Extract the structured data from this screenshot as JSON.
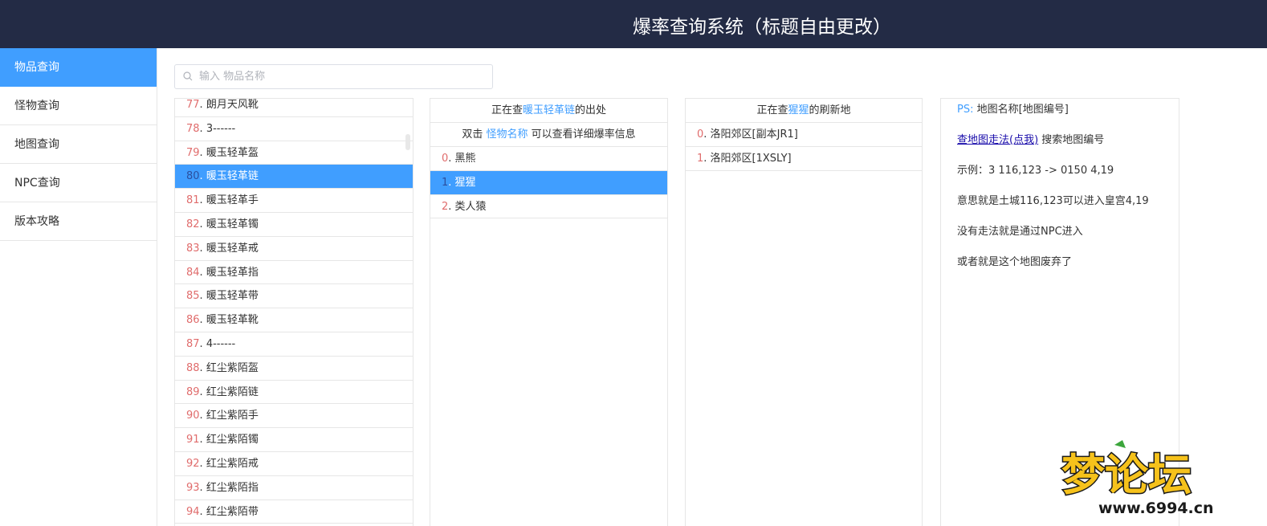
{
  "header": {
    "title": "爆率查询系统（标题自由更改）"
  },
  "sidebar": {
    "items": [
      {
        "label": "物品查询",
        "active": true
      },
      {
        "label": "怪物查询",
        "active": false
      },
      {
        "label": "地图查询",
        "active": false
      },
      {
        "label": "NPC查询",
        "active": false
      },
      {
        "label": "版本攻略",
        "active": false
      }
    ]
  },
  "search": {
    "placeholder": "输入 物品名称",
    "value": "",
    "icon": "search-icon"
  },
  "items_list": {
    "items": [
      {
        "num": "77",
        "name": "朗月天风靴"
      },
      {
        "num": "78",
        "name": "3------"
      },
      {
        "num": "79",
        "name": "暖玉轻革盔"
      },
      {
        "num": "80",
        "name": "暖玉轻革链",
        "selected": true
      },
      {
        "num": "81",
        "name": "暖玉轻革手"
      },
      {
        "num": "82",
        "name": "暖玉轻革镯"
      },
      {
        "num": "83",
        "name": "暖玉轻革戒"
      },
      {
        "num": "84",
        "name": "暖玉轻革指"
      },
      {
        "num": "85",
        "name": "暖玉轻革带"
      },
      {
        "num": "86",
        "name": "暖玉轻革靴"
      },
      {
        "num": "87",
        "name": "4------"
      },
      {
        "num": "88",
        "name": "红尘紫陌盔"
      },
      {
        "num": "89",
        "name": "红尘紫陌链"
      },
      {
        "num": "90",
        "name": "红尘紫陌手"
      },
      {
        "num": "91",
        "name": "红尘紫陌镯"
      },
      {
        "num": "92",
        "name": "红尘紫陌戒"
      },
      {
        "num": "93",
        "name": "红尘紫陌指"
      },
      {
        "num": "94",
        "name": "红尘紫陌带"
      }
    ]
  },
  "source_panel": {
    "head_prefix": "正在查",
    "head_item": "暖玉轻革链",
    "head_suffix": "的出处",
    "hint_prefix": "双击 ",
    "hint_link": "怪物名称",
    "hint_suffix": " 可以查看详细爆率信息",
    "monsters": [
      {
        "num": "0",
        "name": "黑熊"
      },
      {
        "num": "1",
        "name": "猩猩",
        "selected": true
      },
      {
        "num": "2",
        "name": "类人猿"
      }
    ]
  },
  "map_panel": {
    "head_prefix": "正在查",
    "head_monster": "猩猩",
    "head_suffix": "的刷新地",
    "maps": [
      {
        "num": "0",
        "name": "洛阳郊区[副本JR1]"
      },
      {
        "num": "1",
        "name": "洛阳郊区[1XSLY]"
      }
    ]
  },
  "info_panel": {
    "ps_label": "PS:",
    "ps_text": "地图名称[地图编号]",
    "link_text": "查地图走法(点我)",
    "link_suffix": " 搜索地图编号",
    "example": "示例：3 116,123 -> 0150 4,19",
    "meaning": "意思就是土城116,123可以进入皇宫4,19",
    "no_path": "没有走法就是通过NPC进入",
    "abandoned": "或者就是这个地图废弃了"
  },
  "watermark": {
    "text": "梦论坛",
    "url": "www.6994.cn"
  },
  "colors": {
    "header_bg": "#232b45",
    "accent": "#409eff",
    "number": "#e06c6c"
  }
}
